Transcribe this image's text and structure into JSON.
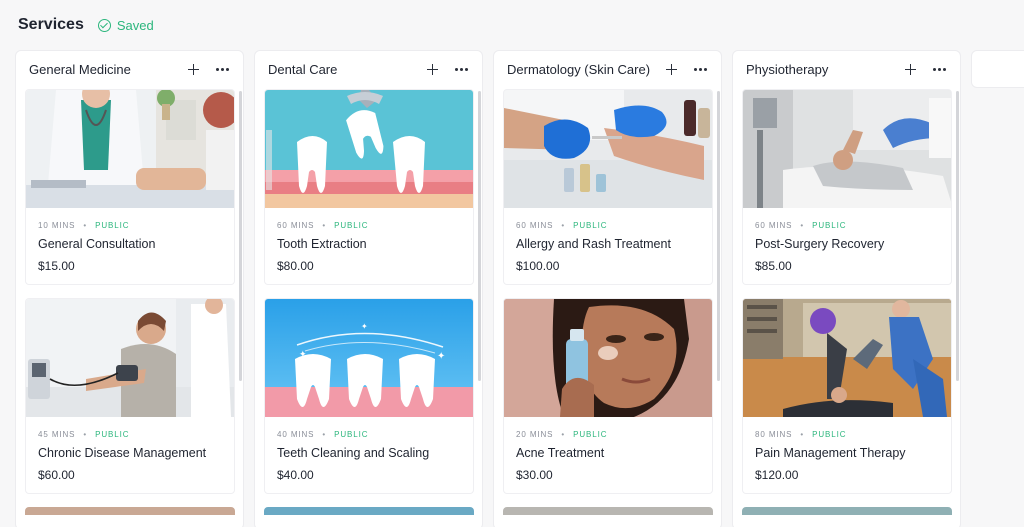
{
  "header": {
    "title": "Services",
    "saved_label": "Saved"
  },
  "columns": [
    {
      "title": "General Medicine",
      "cards": [
        {
          "duration": "10 MINS",
          "visibility": "PUBLIC",
          "name": "General Consultation",
          "price": "$15.00"
        },
        {
          "duration": "45 MINS",
          "visibility": "PUBLIC",
          "name": "Chronic Disease Management",
          "price": "$60.00"
        }
      ]
    },
    {
      "title": "Dental Care",
      "cards": [
        {
          "duration": "60 MINS",
          "visibility": "PUBLIC",
          "name": "Tooth Extraction",
          "price": "$80.00"
        },
        {
          "duration": "40 MINS",
          "visibility": "PUBLIC",
          "name": "Teeth Cleaning and Scaling",
          "price": "$40.00"
        }
      ]
    },
    {
      "title": "Dermatology (Skin Care)",
      "cards": [
        {
          "duration": "60 MINS",
          "visibility": "PUBLIC",
          "name": "Allergy and Rash Treatment",
          "price": "$100.00"
        },
        {
          "duration": "20 MINS",
          "visibility": "PUBLIC",
          "name": "Acne Treatment",
          "price": "$30.00"
        }
      ]
    },
    {
      "title": "Physiotherapy",
      "cards": [
        {
          "duration": "60 MINS",
          "visibility": "PUBLIC",
          "name": "Post-Surgery Recovery",
          "price": "$85.00"
        },
        {
          "duration": "80 MINS",
          "visibility": "PUBLIC",
          "name": "Pain Management Therapy",
          "price": "$120.00"
        }
      ]
    }
  ],
  "colors": {
    "accent_green": "#2cb67d",
    "text": "#1f2430",
    "muted": "#8a8e98"
  },
  "icons": {
    "saved": "check-circle-icon",
    "add": "plus-icon",
    "more": "more-horizontal-icon"
  }
}
